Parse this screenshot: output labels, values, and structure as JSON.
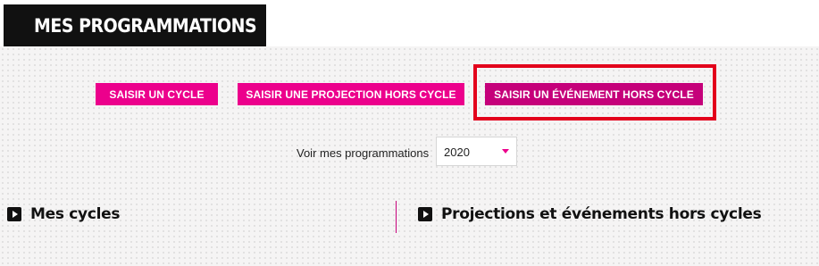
{
  "header": {
    "title": "MES PROGRAMMATIONS",
    "icon": "calendar-icon"
  },
  "actions": {
    "cycle_label": "SAISIR UN CYCLE",
    "projection_label": "SAISIR UNE PROJECTION HORS CYCLE",
    "event_label": "SAISIR UN ÉVÉNEMENT HORS CYCLE"
  },
  "filter": {
    "label": "Voir mes programmations",
    "selected_year": "2020"
  },
  "sections": {
    "cycles_title": "Mes cycles",
    "projections_title": "Projections et événements hors cycles"
  },
  "colors": {
    "accent": "#ec008c",
    "accent_dark": "#c5007a",
    "highlight": "#e3001b",
    "header_bg": "#111111"
  }
}
